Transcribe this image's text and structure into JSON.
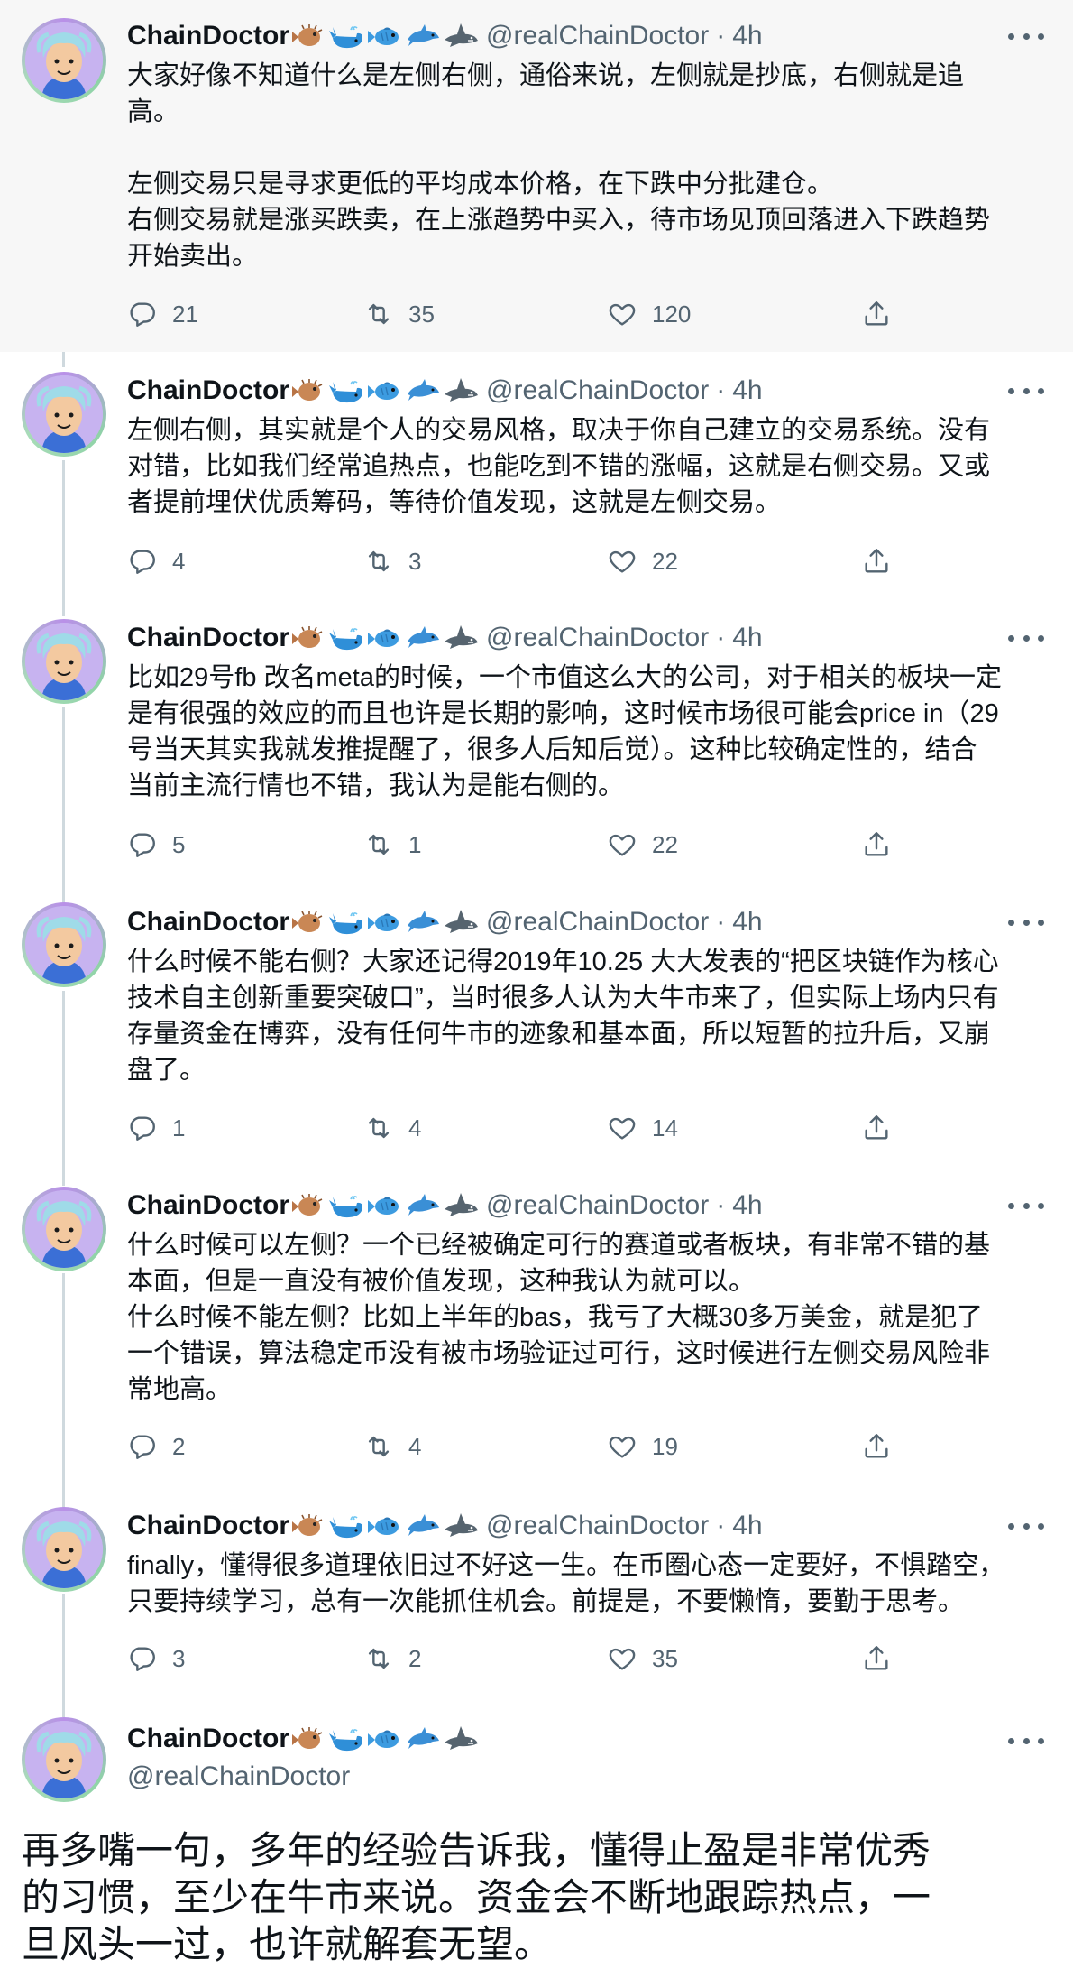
{
  "author": {
    "name": "ChainDoctor",
    "handle": "@realChainDoctor",
    "emoji_icons": [
      "puffer-fish-icon",
      "whale-icon",
      "fish-icon",
      "dolphin-icon",
      "shark-icon"
    ]
  },
  "thread": [
    {
      "time": "4h",
      "lines": [
        "大家好像不知道什么是左侧右侧，通俗来说，左侧就是抄底，右侧就是追",
        "高。",
        "",
        "左侧交易只是寻求更低的平均成本价格，在下跌中分批建仓。",
        "右侧交易就是涨买跌卖，在上涨趋势中买入，待市场见顶回落进入下跌趋势",
        "开始卖出。"
      ],
      "replies": "21",
      "retweets": "35",
      "likes": "120"
    },
    {
      "time": "4h",
      "lines": [
        "左侧右侧，其实就是个人的交易风格，取决于你自己建立的交易系统。没有",
        "对错，比如我们经常追热点，也能吃到不错的涨幅，这就是右侧交易。又或",
        "者提前埋伏优质筹码，等待价值发现，这就是左侧交易。"
      ],
      "replies": "4",
      "retweets": "3",
      "likes": "22"
    },
    {
      "time": "4h",
      "lines": [
        "比如29号fb 改名meta的时候，一个市值这么大的公司，对于相关的板块一定",
        "是有很强的效应的而且也许是长期的影响，这时候市场很可能会price in（29",
        "号当天其实我就发推提醒了，很多人后知后觉）。这种比较确定性的，结合",
        "当前主流行情也不错，我认为是能右侧的。"
      ],
      "replies": "5",
      "retweets": "1",
      "likes": "22"
    },
    {
      "time": "4h",
      "lines": [
        "什么时候不能右侧？大家还记得2019年10.25 大大发表的“把区块链作为核心",
        "技术自主创新重要突破口”，当时很多人认为大牛市来了，但实际上场内只有",
        "存量资金在博弈，没有任何牛市的迹象和基本面，所以短暂的拉升后，又崩",
        "盘了。"
      ],
      "replies": "1",
      "retweets": "4",
      "likes": "14"
    },
    {
      "time": "4h",
      "lines": [
        "什么时候可以左侧？一个已经被确定可行的赛道或者板块，有非常不错的基",
        "本面，但是一直没有被价值发现，这种我认为就可以。",
        "什么时候不能左侧？比如上半年的bas，我亏了大概30多万美金，就是犯了",
        "一个错误，算法稳定币没有被市场验证过可行，这时候进行左侧交易风险非",
        "常地高。"
      ],
      "replies": "2",
      "retweets": "4",
      "likes": "19"
    },
    {
      "time": "4h",
      "lines": [
        "finally，懂得很多道理依旧过不好这一生。在币圈心态一定要好，不惧踏空，",
        "只要持续学习，总有一次能抓住机会。前提是，不要懒惰，要勤于思考。"
      ],
      "replies": "3",
      "retweets": "2",
      "likes": "35"
    }
  ],
  "main_tweet": {
    "lines": [
      "再多嘴一句，多年的经验告诉我，懂得止盈是非常优秀",
      "的习惯，至少在牛市来说。资金会不断地跟踪热点，一",
      "旦风头一过，也许就解套无望。"
    ]
  }
}
